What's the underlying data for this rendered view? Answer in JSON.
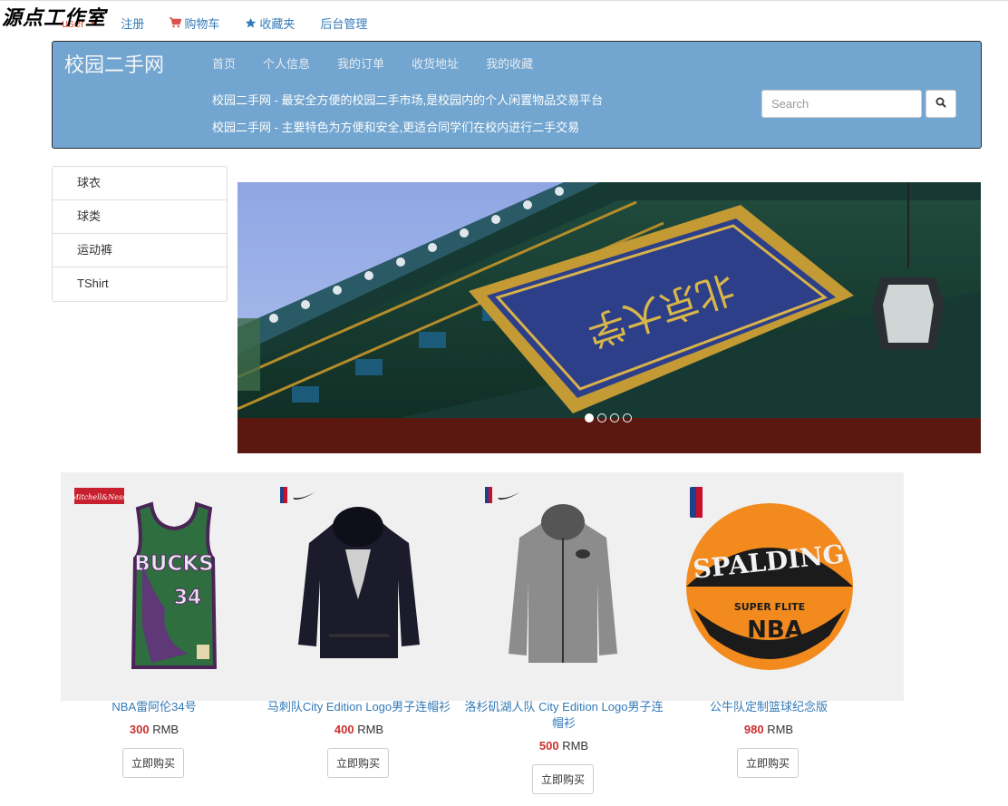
{
  "watermark": "源点工作室",
  "topnav": {
    "user": "user",
    "register": "注册",
    "cart": "购物车",
    "favorites": "收藏夹",
    "admin": "后台管理"
  },
  "banner": {
    "brand": "校园二手网",
    "nav": [
      "首页",
      "个人信息",
      "我的订单",
      "收货地址",
      "我的收藏"
    ],
    "tagline1": "校园二手网 - 最安全方便的校园二手市场,是校园内的个人闲置物品交易平台",
    "tagline2": "校园二手网 - 主要特色为方便和安全,更适合同学们在校内进行二手交易",
    "search_placeholder": "Search"
  },
  "categories": [
    "球衣",
    "球类",
    "运动裤",
    "TShirt"
  ],
  "carousel": {
    "slide_count": 4,
    "active_index": 0,
    "sign_text": "北京大学"
  },
  "products": [
    {
      "name": "NBA雷阿伦34号",
      "price": "300",
      "currency": "RMB",
      "buy_label": "立即购买",
      "jersey_text": "BUCKS",
      "jersey_number": "34"
    },
    {
      "name": "马刺队City Edition Logo男子连帽衫",
      "price": "400",
      "currency": "RMB",
      "buy_label": "立即购买"
    },
    {
      "name": "洛杉矶湖人队 City Edition Logo男子连帽衫",
      "price": "500",
      "currency": "RMB",
      "buy_label": "立即购买"
    },
    {
      "name": "公牛队定制篮球纪念版",
      "price": "980",
      "currency": "RMB",
      "buy_label": "立即购买",
      "ball_brand": "SPALDING",
      "ball_line": "SUPER FLITE",
      "ball_logo": "NBA"
    }
  ],
  "colors": {
    "banner_bg": "#72a5cf",
    "link": "#337ab7",
    "price": "#c9302c",
    "user": "#e0563a"
  }
}
